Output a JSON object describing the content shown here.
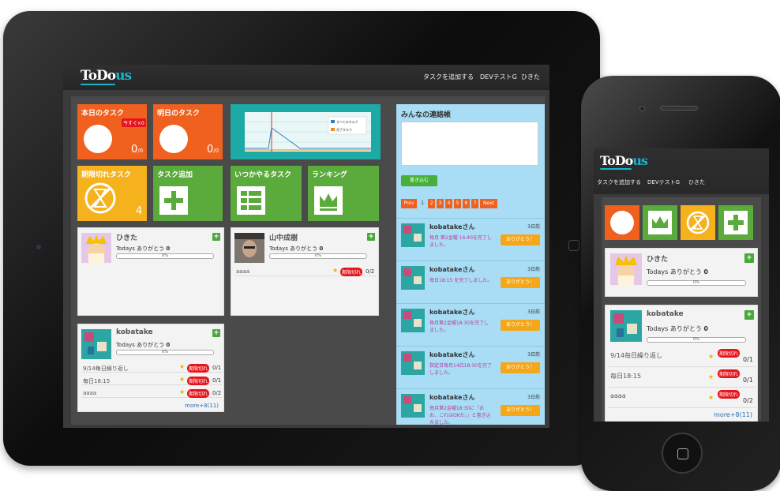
{
  "app": {
    "logo_main": "ToDo",
    "logo_accent": "us"
  },
  "nav": {
    "add_task": "タスクを追加する",
    "group": "DEVテストG",
    "user": "ひきた"
  },
  "tiles": {
    "today": {
      "label": "本日のタスク",
      "badge": "今すぐ×0",
      "count": "0",
      "count_suffix": "/0"
    },
    "tomorrow": {
      "label": "明日のタスク",
      "count": "0",
      "count_suffix": "/0"
    },
    "chart_legend": [
      "すべてのタスク",
      "完了タスク"
    ],
    "expired": {
      "label": "期限切れタスク",
      "count": "4"
    },
    "add": {
      "label": "タスク追加"
    },
    "someday": {
      "label": "いつかやるタスク"
    },
    "ranking": {
      "label": "ランキング"
    }
  },
  "colors": {
    "orange": "#f0601f",
    "yellow": "#f5b21d",
    "green": "#5aaa3c",
    "teal": "#1da9a5",
    "board": "#a8ddf5",
    "accent": "#19b5c8"
  },
  "users": [
    {
      "name": "ひきた",
      "thanks_label": "Todays ありがとう",
      "thanks_count": "0",
      "progress": "0%",
      "progress_value": 0,
      "tasks": []
    },
    {
      "name": "山中成樹",
      "thanks_label": "Todays ありがとう",
      "thanks_count": "0",
      "progress": "0%",
      "progress_value": 0,
      "tasks": [
        {
          "title": "aaaa",
          "badge": "期限切れ",
          "ratio": "0/2"
        }
      ]
    },
    {
      "name": "kobatake",
      "thanks_label": "Todays ありがとう",
      "thanks_count": "0",
      "progress": "0%",
      "progress_value": 0,
      "tasks": [
        {
          "title": "9/14毎日繰り返し",
          "badge": "期限切れ",
          "ratio": "0/1"
        },
        {
          "title": "毎日18:15",
          "badge": "期限切れ",
          "ratio": "0/1"
        },
        {
          "title": "aaaa",
          "badge": "期限切れ",
          "ratio": "0/2"
        }
      ],
      "more": "more+8(11)"
    }
  ],
  "board": {
    "title": "みんなの連絡帳",
    "write_button": "書き込む",
    "pagination": [
      "Prev",
      "1",
      "2",
      "3",
      "4",
      "5",
      "6",
      "7",
      "Next"
    ],
    "posts": [
      {
        "name": "kobatakeさん",
        "date": "3日前",
        "message": "毎月 第2金曜 16:40を完了しました。",
        "button": "ありがとう！"
      },
      {
        "name": "kobatakeさん",
        "date": "3日前",
        "message": "毎日18:15 を完了しました。",
        "button": "ありがとう！"
      },
      {
        "name": "kobatakeさん",
        "date": "3日前",
        "message": "毎月第2金曜18:30を完了しました。",
        "button": "ありがとう！"
      },
      {
        "name": "kobatakeさん",
        "date": "3日前",
        "message": "指定日毎月14日18:30を完了しました。",
        "button": "ありがとう！"
      },
      {
        "name": "kobatakeさん",
        "date": "3日前",
        "message": "毎月第2金曜18:30に「おお、これはOKだ。」と書き込みました。",
        "button": "ありがとう！"
      }
    ]
  },
  "phone": {
    "users": [
      {
        "name": "ひきた",
        "thanks_label": "Todays ありがとう",
        "thanks_count": "0",
        "progress": "0%"
      },
      {
        "name": "kobatake",
        "thanks_label": "Todays ありがとう",
        "thanks_count": "0",
        "progress": "0%",
        "tasks": [
          {
            "title": "9/14毎日繰り返し",
            "badge": "期限切れ",
            "ratio": "0/1"
          },
          {
            "title": "毎日18:15",
            "badge": "期限切れ",
            "ratio": "0/1"
          },
          {
            "title": "aaaa",
            "badge": "期限切れ",
            "ratio": "0/2"
          }
        ],
        "more": "more+8(11)"
      }
    ]
  }
}
